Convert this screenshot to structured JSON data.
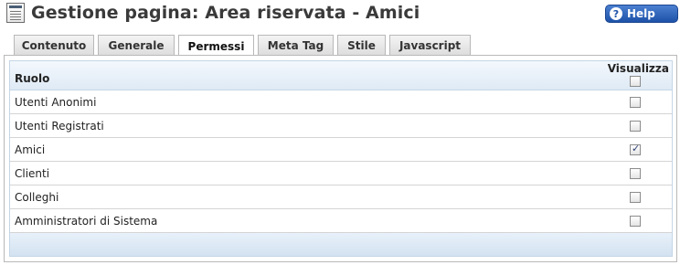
{
  "header": {
    "title": "Gestione pagina: Area riservata - Amici",
    "icon": "page-edit-icon",
    "help_label": "Help",
    "help_icon": "question-icon"
  },
  "tabs": [
    {
      "label": "Contenuto",
      "active": false
    },
    {
      "label": "Generale",
      "active": false
    },
    {
      "label": "Permessi",
      "active": true
    },
    {
      "label": "Meta Tag",
      "active": false
    },
    {
      "label": "Stile",
      "active": false
    },
    {
      "label": "Javascript",
      "active": false
    }
  ],
  "permissions": {
    "col_role": "Ruolo",
    "col_view": "Visualizza",
    "select_all_checked": false,
    "rows": [
      {
        "role": "Utenti Anonimi",
        "checked": false
      },
      {
        "role": "Utenti Registrati",
        "checked": false
      },
      {
        "role": "Amici",
        "checked": true
      },
      {
        "role": "Clienti",
        "checked": false
      },
      {
        "role": "Colleghi",
        "checked": false
      },
      {
        "role": "Amministratori di Sistema",
        "checked": false
      }
    ]
  },
  "colors": {
    "help_button": "#1d52a8",
    "header_bg": "#dfeaf5",
    "border": "#c5d6e6"
  }
}
